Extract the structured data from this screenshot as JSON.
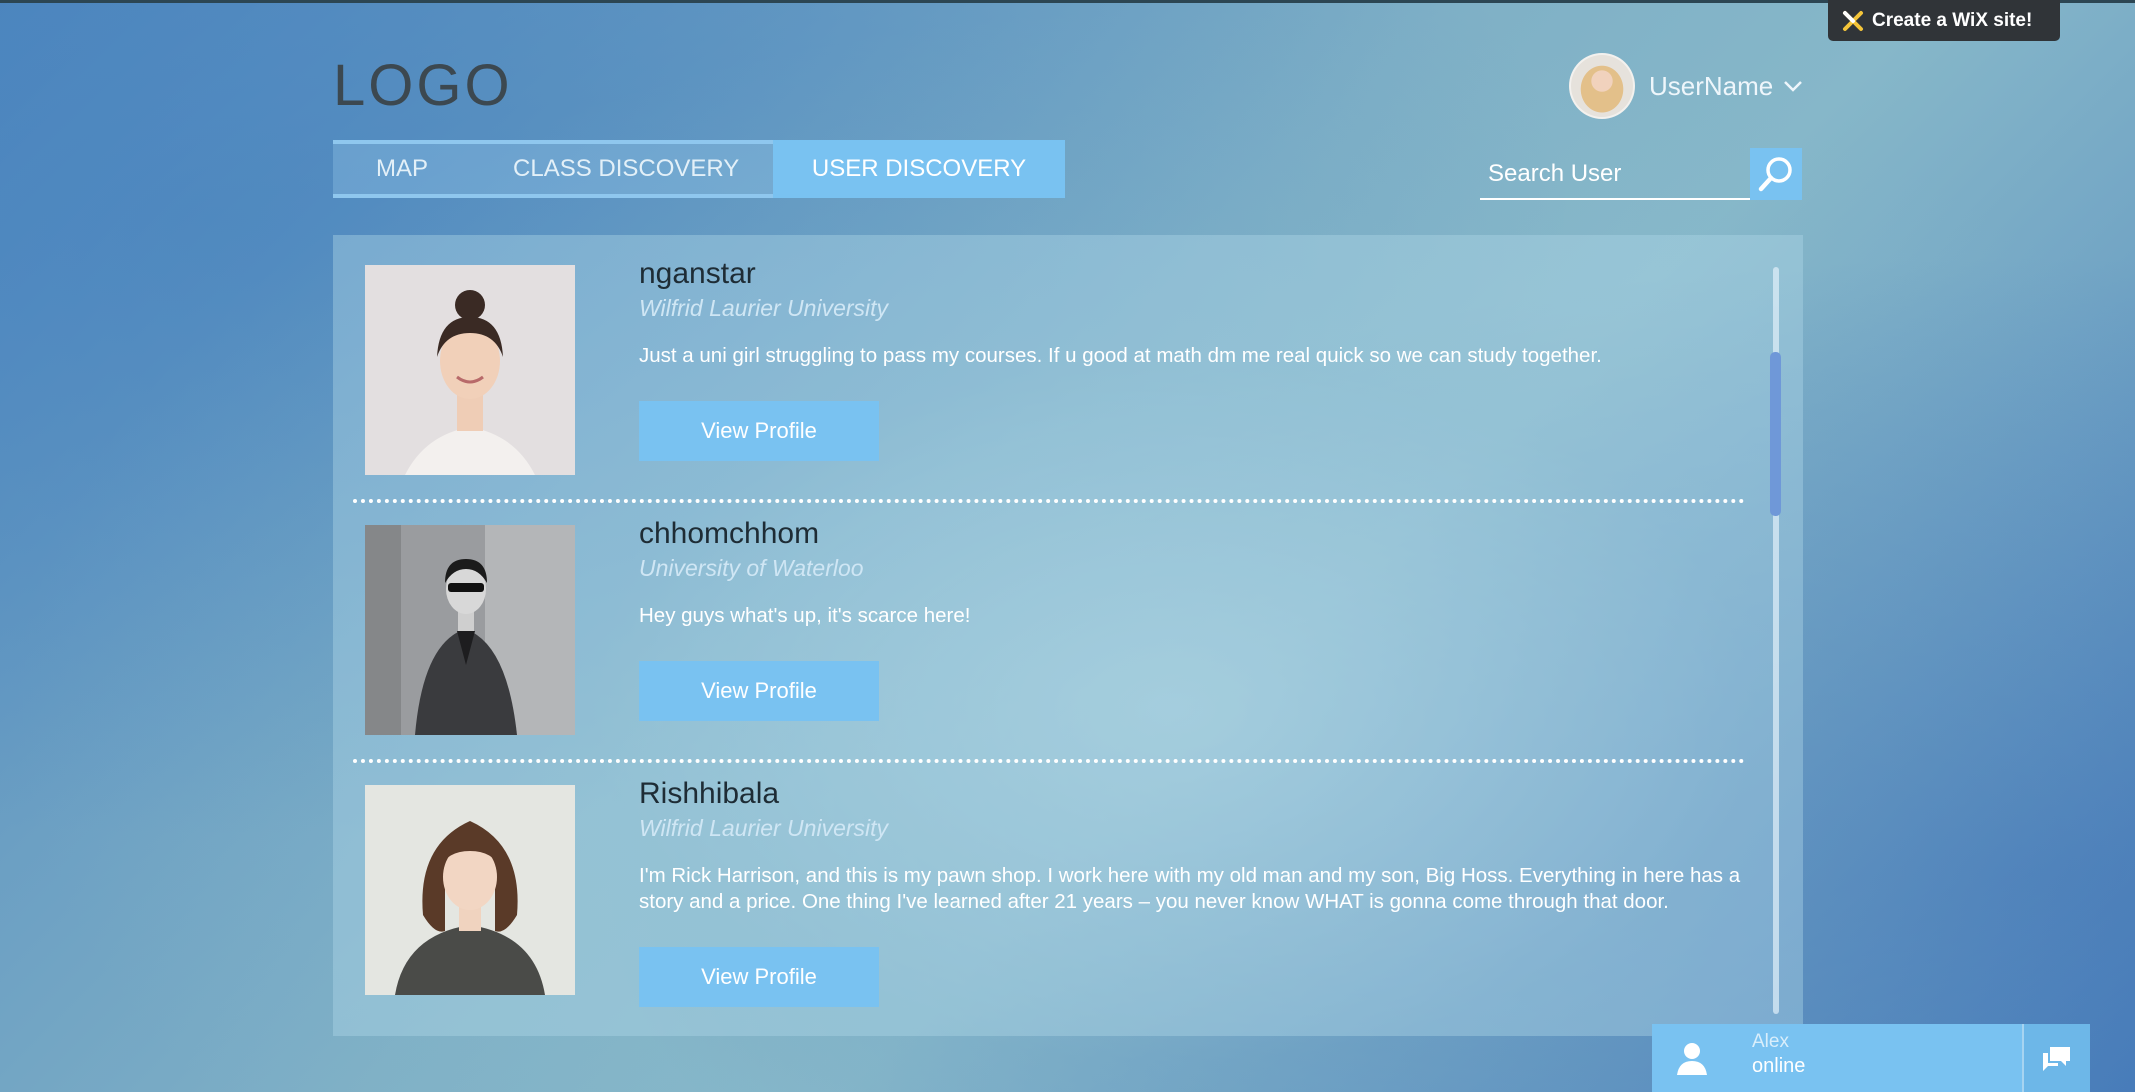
{
  "header": {
    "logo": "LOGO",
    "username": "UserName"
  },
  "nav": {
    "tabs": [
      {
        "label": "MAP"
      },
      {
        "label": "CLASS DISCOVERY"
      },
      {
        "label": "USER DISCOVERY",
        "active": true
      }
    ]
  },
  "search": {
    "placeholder": "Search User"
  },
  "users": [
    {
      "name": "nganstar",
      "university": "Wilfrid Laurier University",
      "bio": "Just a uni girl struggling to pass my courses. If u good at math dm me real quick so we can study together.",
      "button": "View Profile"
    },
    {
      "name": "chhomchhom",
      "university": "University of Waterloo",
      "bio": "Hey guys what's up, it's scarce here!",
      "button": "View Profile"
    },
    {
      "name": "Rishhibala",
      "university": "Wilfrid Laurier University",
      "bio": "I'm Rick Harrison, and this is my pawn shop. I work here with my old man and my son, Big Hoss. Everything in here has a story and a price. One thing I've learned after 21 years – you never know WHAT is gonna come through that door.",
      "button": "View Profile"
    }
  ],
  "wix_banner": {
    "text": "Create a WiX site!"
  },
  "chat": {
    "name": "Alex",
    "status": "online"
  },
  "colors": {
    "accent": "#79c2f1",
    "panel_text": "#ffffff"
  }
}
